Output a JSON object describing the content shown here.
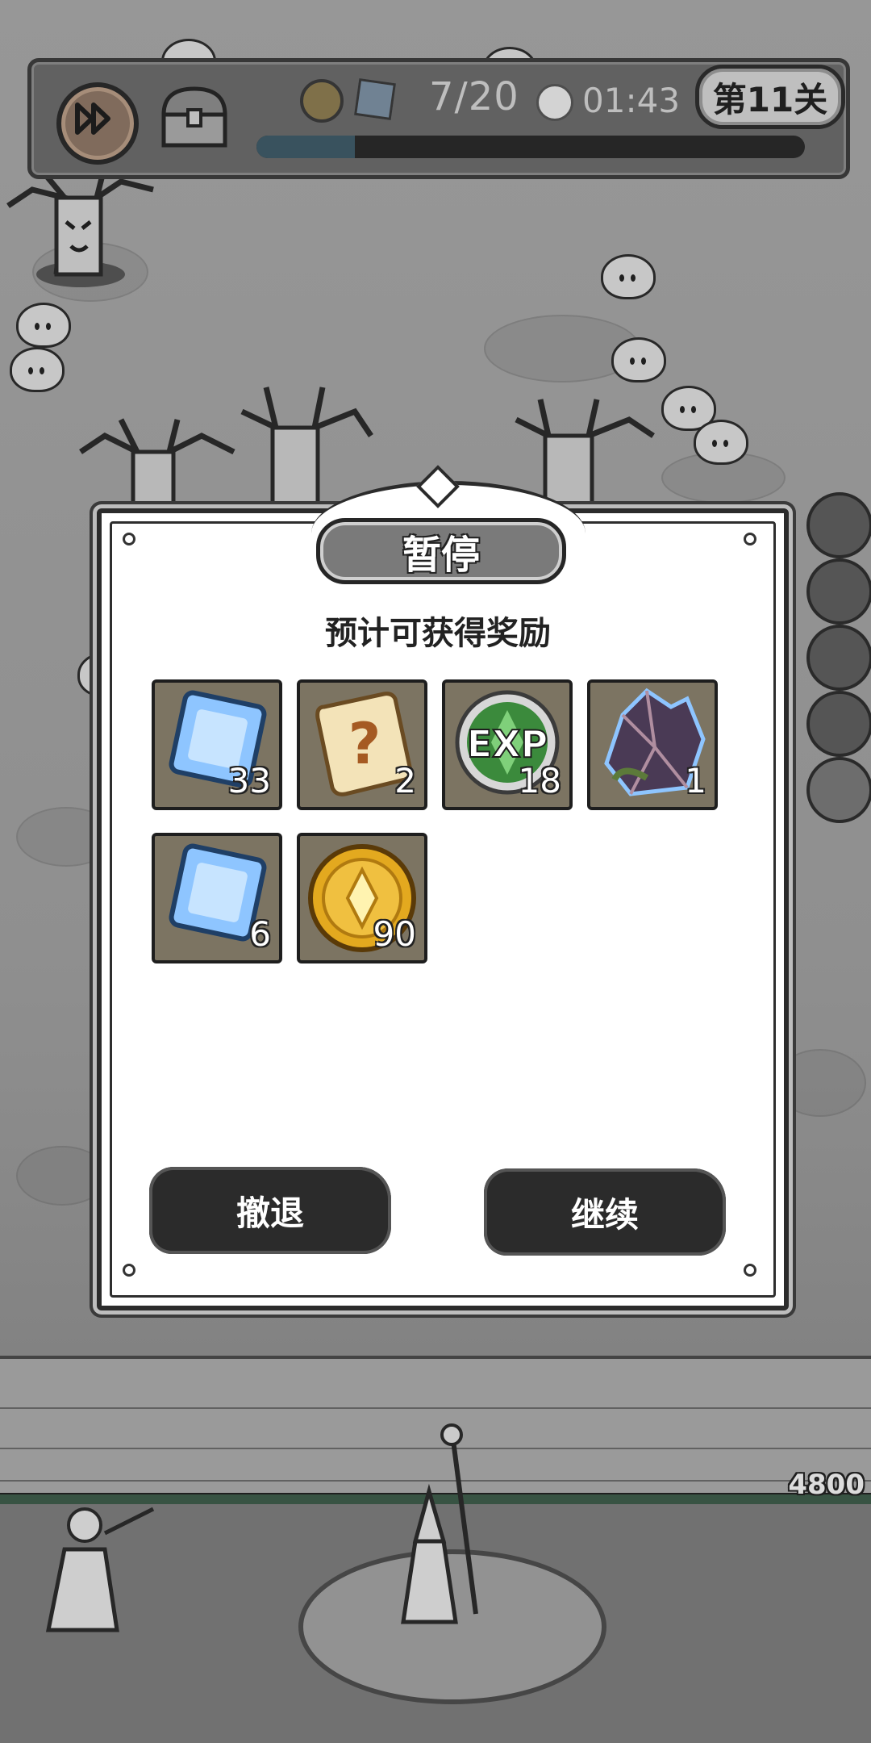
{
  "hud": {
    "wave_text": "7/20",
    "timer_text": "01:43",
    "level_text": "第11关",
    "progress_fraction": 0.18,
    "icons": [
      "fast-forward-icon",
      "treasure-chest-icon",
      "gold-coin-icon",
      "blue-gem-icon",
      "clock-icon"
    ]
  },
  "player": {
    "hp_text": "4800"
  },
  "pause_dialog": {
    "title": "暂停",
    "subtitle": "预计可获得奖励",
    "rewards": [
      {
        "icon": "blue-gem-icon",
        "count": "33"
      },
      {
        "icon": "mystery-scroll-icon",
        "count": "2"
      },
      {
        "icon": "exp-orb-icon",
        "count": "18"
      },
      {
        "icon": "dark-crystal-icon",
        "count": "1"
      },
      {
        "icon": "blue-gem-icon",
        "count": "6"
      },
      {
        "icon": "gold-coin-icon",
        "count": "90"
      }
    ],
    "retreat_label": "撤退",
    "continue_label": "继续",
    "exp_text": "EXP"
  },
  "colors": {
    "gem_blue": "#8ec5ff",
    "gold": "#e3a91f",
    "exp_green": "#3b8a3c",
    "item_bg": "#7c7462",
    "button_dark": "#2b2b2b"
  }
}
